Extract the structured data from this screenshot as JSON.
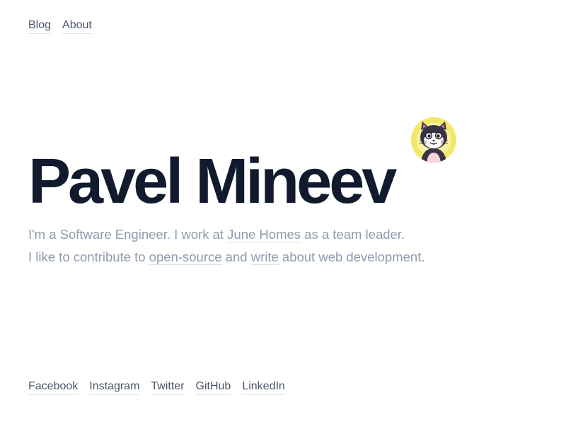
{
  "nav": {
    "items": [
      {
        "label": "Blog"
      },
      {
        "label": "About"
      }
    ]
  },
  "hero": {
    "name": "Pavel Mineev",
    "avatar_icon": "cat-avatar-icon"
  },
  "bio": {
    "line1_prefix": "I'm a Software Engineer. I work at ",
    "company_link": "June Homes",
    "line1_suffix": " as a team leader.",
    "line2_prefix": "I like to contribute to ",
    "opensource_link": "open-source",
    "line2_middle": " and ",
    "write_link": "write",
    "line2_suffix": " about web development."
  },
  "social": {
    "links": [
      {
        "label": "Facebook"
      },
      {
        "label": "Instagram"
      },
      {
        "label": "Twitter"
      },
      {
        "label": "GitHub"
      },
      {
        "label": "LinkedIn"
      }
    ]
  },
  "colors": {
    "heading": "#121a2e",
    "muted_text": "#8f9aac",
    "link_text": "#4a5568",
    "avatar_bg": "#f4e86a"
  }
}
